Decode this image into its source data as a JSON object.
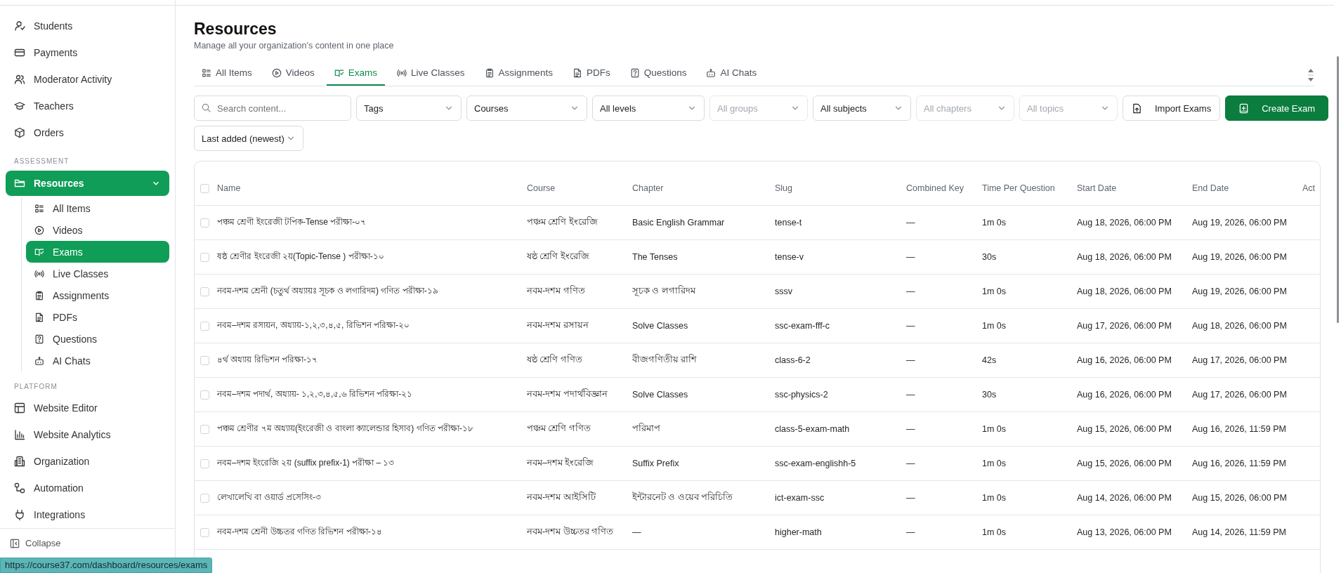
{
  "sidebar": {
    "sections": [
      {
        "items": [
          {
            "label": "Students",
            "selected": false
          },
          {
            "label": "Payments",
            "selected": false
          },
          {
            "label": "Moderator Activity",
            "selected": false
          },
          {
            "label": "Teachers",
            "selected": false
          },
          {
            "label": "Orders",
            "selected": false
          }
        ]
      },
      {
        "heading": "ASSESSMENT",
        "items": [
          {
            "label": "Resources",
            "selected": true,
            "expanded": true,
            "children": [
              {
                "label": "All Items",
                "selected": false
              },
              {
                "label": "Videos",
                "selected": false
              },
              {
                "label": "Exams",
                "selected": true
              },
              {
                "label": "Live Classes",
                "selected": false
              },
              {
                "label": "Assignments",
                "selected": false
              },
              {
                "label": "PDFs",
                "selected": false
              },
              {
                "label": "Questions",
                "selected": false
              },
              {
                "label": "AI Chats",
                "selected": false
              }
            ]
          }
        ]
      },
      {
        "heading": "PLATFORM",
        "items": [
          {
            "label": "Website Editor",
            "selected": false
          },
          {
            "label": "Website Analytics",
            "selected": false
          },
          {
            "label": "Organization",
            "selected": false
          },
          {
            "label": "Automation",
            "selected": false
          },
          {
            "label": "Integrations",
            "selected": false
          }
        ]
      }
    ],
    "collapse": "Collapse"
  },
  "page": {
    "title": "Resources",
    "subtitle": "Manage all your organization's content in one place"
  },
  "tabs": [
    {
      "label": "All Items",
      "selected": false
    },
    {
      "label": "Videos",
      "selected": false
    },
    {
      "label": "Exams",
      "selected": true
    },
    {
      "label": "Live Classes",
      "selected": false
    },
    {
      "label": "Assignments",
      "selected": false
    },
    {
      "label": "PDFs",
      "selected": false
    },
    {
      "label": "Questions",
      "selected": false
    },
    {
      "label": "AI Chats",
      "selected": false
    }
  ],
  "search": {
    "placeholder": "Search content..."
  },
  "filters": [
    {
      "label": "Tags",
      "disabled": false
    },
    {
      "label": "Courses",
      "disabled": false
    },
    {
      "label": "All levels",
      "disabled": false
    },
    {
      "label": "All groups",
      "disabled": true
    },
    {
      "label": "All subjects",
      "disabled": false
    },
    {
      "label": "All chapters",
      "disabled": true
    },
    {
      "label": "All topics",
      "disabled": true
    }
  ],
  "buttons": [
    {
      "label": "Import Exams",
      "kind": "outline"
    },
    {
      "label": "Create Exam",
      "kind": "primary"
    }
  ],
  "sort": {
    "label": "Last added (newest)"
  },
  "table": {
    "header_checked": false,
    "columns": [
      "Name",
      "Course",
      "Chapter",
      "Slug",
      "Combined Key",
      "Time Per Question",
      "Start Date",
      "End Date",
      "Act"
    ],
    "rows": [
      {
        "checked": false,
        "name": "পঞ্চম শ্রেণী ইংরেজী টপিক-Tense পরীক্ষা-০৭",
        "course": "পঞ্চম শ্রেণি ইংরেজি",
        "chapter": "Basic English Grammar",
        "slug": "tense-t",
        "combined_key": "—",
        "time": "1m 0s",
        "start": "Aug 18, 2026, 06:00 PM",
        "end": "Aug 19, 2026, 06:00 PM"
      },
      {
        "checked": false,
        "name": "ষষ্ঠ শ্রেণীর ইংরেজী ২য়(Topic-Tense ) পরীক্ষা-১০",
        "course": "ষষ্ঠ শ্রেণি ইংরেজি",
        "chapter": "The Tenses",
        "slug": "tense-v",
        "combined_key": "—",
        "time": "30s",
        "start": "Aug 18, 2026, 06:00 PM",
        "end": "Aug 19, 2026, 06:00 PM"
      },
      {
        "checked": false,
        "name": "নবম-দশম শ্রেনী (চতুর্থ অধ্যায়ঃ সূচক ও লগারিদম) গণিত পরীক্ষা-১৯",
        "course": "নবম-দশম গণিত",
        "chapter": "সূচক ও লগারিদম",
        "slug": "sssv",
        "combined_key": "—",
        "time": "1m 0s",
        "start": "Aug 18, 2026, 06:00 PM",
        "end": "Aug 19, 2026, 06:00 PM"
      },
      {
        "checked": false,
        "name": "নবম–দশম রসায়ন, অধ্যায়-১,২,৩,৪,৫, রিভিশন পরিক্ষা-২০",
        "course": "নবম-দশম রসায়ন",
        "chapter": "Solve Classes",
        "slug": "ssc-exam-fff-c",
        "combined_key": "—",
        "time": "1m 0s",
        "start": "Aug 17, 2026, 06:00 PM",
        "end": "Aug 18, 2026, 06:00 PM"
      },
      {
        "checked": false,
        "name": "৪র্থ অধ্যায় রিভিশন পরিক্ষা-১৭",
        "course": "ষষ্ঠ শ্রেণি গণিত",
        "chapter": "বীজগণিতীয় রাশি",
        "slug": "class-6-2",
        "combined_key": "—",
        "time": "42s",
        "start": "Aug 16, 2026, 06:00 PM",
        "end": "Aug 17, 2026, 06:00 PM"
      },
      {
        "checked": false,
        "name": "নবম–দশম পদার্থ, অধ্যায়- ১,২,৩,৪,৫,৬ রিভিশন পরিক্ষা-২১",
        "course": "নবম-দশম পদার্থবিজ্ঞান",
        "chapter": "Solve Classes",
        "slug": "ssc-physics-2",
        "combined_key": "—",
        "time": "30s",
        "start": "Aug 16, 2026, 06:00 PM",
        "end": "Aug 17, 2026, 06:00 PM"
      },
      {
        "checked": false,
        "name": "পঞ্চম শ্রেণীর ৭ম অধ্যায়(ইংরেজী ও বাংলা ক্যালেন্ডার হিসাব) গণিত পরীক্ষা-১৮",
        "course": "পঞ্চম শ্রেণি গণিত",
        "chapter": "পরিমাপ",
        "slug": "class-5-exam-math",
        "combined_key": "—",
        "time": "1m 0s",
        "start": "Aug 15, 2026, 06:00 PM",
        "end": "Aug 16, 2026, 11:59 PM"
      },
      {
        "checked": false,
        "name": "নবম–দশম ইংরেজি ২য় (suffix prefix-1) পরীক্ষা – ১৩",
        "course": "নবম–দশম ইংরেজি",
        "chapter": "Suffix Prefix",
        "slug": "ssc-exam-englishh-5",
        "combined_key": "—",
        "time": "1m 0s",
        "start": "Aug 15, 2026, 06:00 PM",
        "end": "Aug 16, 2026, 11:59 PM"
      },
      {
        "checked": false,
        "name": "লেখালেখি বা ওয়ার্ড প্রসেসিং-৩",
        "course": "নবম-দশম আইসিটি",
        "chapter": "ইন্টারনেট ও ওয়েব পরিচিতি",
        "slug": "ict-exam-ssc",
        "combined_key": "—",
        "time": "1m 0s",
        "start": "Aug 14, 2026, 06:00 PM",
        "end": "Aug 15, 2026, 06:00 PM"
      },
      {
        "checked": false,
        "name": "নবম-দশম শ্রেনী উচ্চতর গণিত রিভিশন পরীক্ষা-১৪",
        "course": "নবম-দশম উচ্চতর গণিত",
        "chapter": "—",
        "slug": "higher-math",
        "combined_key": "—",
        "time": "1m 0s",
        "start": "Aug 13, 2026, 06:00 PM",
        "end": "Aug 14, 2026, 11:59 PM"
      }
    ]
  },
  "status_url": "https://course37.com/dashboard/resources/exams"
}
